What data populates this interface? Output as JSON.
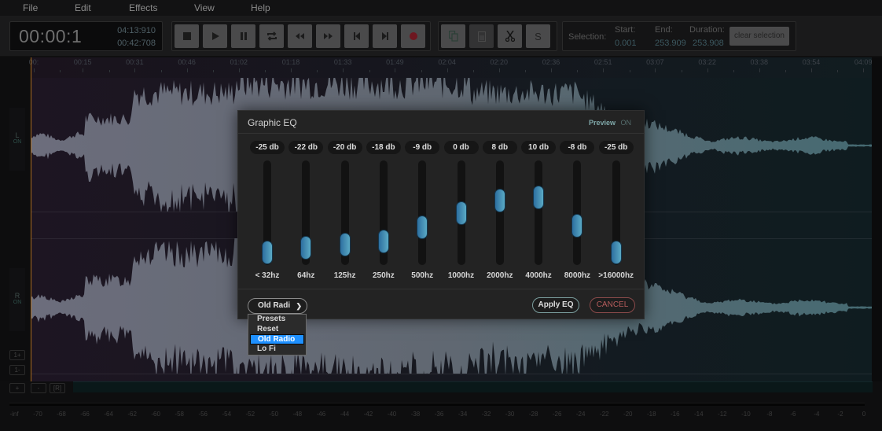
{
  "menu": [
    "File",
    "Edit",
    "Effects",
    "View",
    "Help"
  ],
  "timer": {
    "current": "00:00:1",
    "total": "04:13:910",
    "position": "00:42:708"
  },
  "transport": [
    {
      "name": "stop-button",
      "icon": "stop-icon"
    },
    {
      "name": "play-button",
      "icon": "play-icon"
    },
    {
      "name": "pause-button",
      "icon": "pause-icon"
    },
    {
      "name": "loop-button",
      "icon": "loop-icon"
    },
    {
      "name": "rewind-button",
      "icon": "rewind-icon"
    },
    {
      "name": "fast-forward-button",
      "icon": "fast-forward-icon"
    },
    {
      "name": "skip-to-start-button",
      "icon": "skip-start-icon"
    },
    {
      "name": "skip-to-end-button",
      "icon": "skip-end-icon"
    },
    {
      "name": "record-button",
      "icon": "record-icon"
    }
  ],
  "edit_tools": [
    {
      "name": "copy-button",
      "icon": "copy-icon"
    },
    {
      "name": "paste-button",
      "icon": "paste-icon"
    },
    {
      "name": "cut-button",
      "icon": "scissors-icon"
    },
    {
      "name": "silence-button",
      "icon": "s-icon",
      "label": "S"
    }
  ],
  "selection": {
    "label": "Selection:",
    "start_label": "Start:",
    "start": "0.001",
    "end_label": "End:",
    "end": "253.909",
    "duration_label": "Duration:",
    "duration": "253.908",
    "clear_label": "clear selection"
  },
  "ruler": [
    "00:",
    "00:15",
    "00:31",
    "00:46",
    "01:02",
    "01:18",
    "01:33",
    "01:49",
    "02:04",
    "02:20",
    "02:36",
    "02:51",
    "03:07",
    "03:22",
    "03:38",
    "03:54",
    "04:09"
  ],
  "channels": [
    {
      "name": "L",
      "state": "ON"
    },
    {
      "name": "R",
      "state": "ON"
    }
  ],
  "side_buttons": [
    "1+",
    "1-",
    "+",
    "-",
    "[R]"
  ],
  "meter_labels": [
    "-inf",
    "-70",
    "-68",
    "-66",
    "-64",
    "-62",
    "-60",
    "-58",
    "-56",
    "-54",
    "-52",
    "-50",
    "-48",
    "-46",
    "-44",
    "-42",
    "-40",
    "-38",
    "-36",
    "-34",
    "-32",
    "-30",
    "-28",
    "-26",
    "-24",
    "-22",
    "-20",
    "-18",
    "-16",
    "-14",
    "-12",
    "-10",
    "-8",
    "-6",
    "-4",
    "-2",
    "0"
  ],
  "eq": {
    "title": "Graphic EQ",
    "preview_label": "Preview",
    "preview_state": "ON",
    "range_db": [
      -25,
      25
    ],
    "bands": [
      {
        "freq": "< 32hz",
        "db_label": "-25 db",
        "db": -25
      },
      {
        "freq": "64hz",
        "db_label": "-22 db",
        "db": -22
      },
      {
        "freq": "125hz",
        "db_label": "-20 db",
        "db": -20
      },
      {
        "freq": "250hz",
        "db_label": "-18 db",
        "db": -18
      },
      {
        "freq": "500hz",
        "db_label": "-9 db",
        "db": -9
      },
      {
        "freq": "1000hz",
        "db_label": "0 db",
        "db": 0
      },
      {
        "freq": "2000hz",
        "db_label": "8 db",
        "db": 8
      },
      {
        "freq": "4000hz",
        "db_label": "10 db",
        "db": 10
      },
      {
        "freq": "8000hz",
        "db_label": "-8 db",
        "db": -8
      },
      {
        "freq": ">16000hz",
        "db_label": "-25 db",
        "db": -25
      }
    ],
    "preset_value": "Old Radi",
    "apply_label": "Apply EQ",
    "cancel_label": "CANCEL",
    "preset_options": [
      "Presets",
      "Reset",
      "Old Radio",
      "Lo Fi"
    ],
    "preset_selected": "Old Radio"
  }
}
